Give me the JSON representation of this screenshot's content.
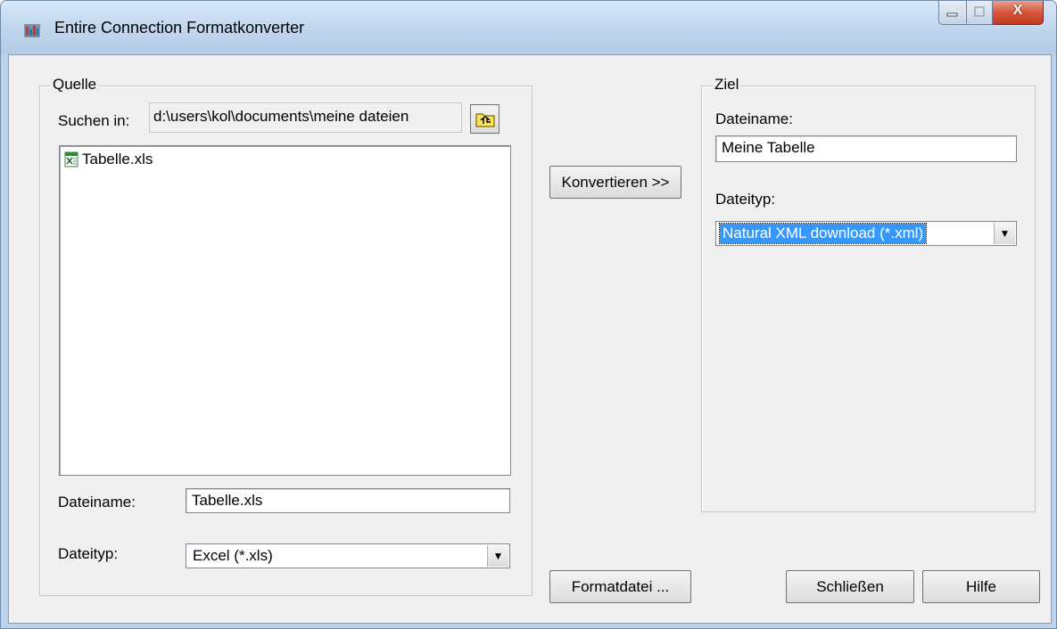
{
  "window": {
    "title": "Entire Connection Formatkonverter",
    "caption_buttons": [
      "minimize",
      "maximize",
      "close"
    ],
    "close_glyph": "X"
  },
  "source": {
    "group_label": "Quelle",
    "search_in_label": "Suchen in:",
    "search_in_path": "d:\\users\\kol\\documents\\meine dateien",
    "up_folder_icon": "folder-up-icon",
    "files": [
      {
        "name": "Tabelle.xls",
        "icon": "excel-file-icon"
      }
    ],
    "filename_label": "Dateiname:",
    "filename_value": "Tabelle.xls",
    "filetype_label": "Dateityp:",
    "filetype_value": "Excel (*.xls)"
  },
  "convert_button": "Konvertieren >>",
  "format_file_button": "Formatdatei ...",
  "target": {
    "group_label": "Ziel",
    "filename_label": "Dateiname:",
    "filename_value": "Meine Tabelle",
    "filetype_label": "Dateityp:",
    "filetype_value": "Natural XML download (*.xml)"
  },
  "close_button": "Schließen",
  "help_button": "Hilfe",
  "colors": {
    "selection": "#3399ff",
    "dialog_bg": "#f0f0f0",
    "close_button_red": "#c13a20"
  }
}
